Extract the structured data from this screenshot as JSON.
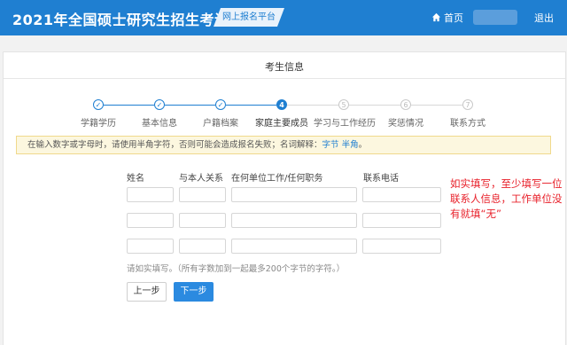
{
  "header": {
    "app_title": "2021年全国硕士研究生招生考试",
    "platform_tag": "网上报名平台",
    "home_label": "首页",
    "logout_label": "退出"
  },
  "card": {
    "title": "考生信息"
  },
  "steps": [
    {
      "number": "✓",
      "label": "学籍学历",
      "state": "done"
    },
    {
      "number": "✓",
      "label": "基本信息",
      "state": "done"
    },
    {
      "number": "✓",
      "label": "户籍档案",
      "state": "done"
    },
    {
      "number": "4",
      "label": "家庭主要成员",
      "state": "active"
    },
    {
      "number": "5",
      "label": "学习与工作经历",
      "state": "todo"
    },
    {
      "number": "6",
      "label": "奖惩情况",
      "state": "todo"
    },
    {
      "number": "7",
      "label": "联系方式",
      "state": "todo"
    }
  ],
  "notice": {
    "text": "在输入数字或字母时，请使用半角字符，否则可能会造成报名失败；名词解释：",
    "link1": "字节",
    "link2": "半角",
    "end": "。"
  },
  "form": {
    "columns": {
      "name": "姓名",
      "relation": "与本人关系",
      "work_unit": "在何单位工作/任何职务",
      "phone": "联系电话"
    },
    "hint": "请如实填写。（所有字数加到一起最多200个字节的字符。）",
    "prev_button": "上一步",
    "next_button": "下一步"
  },
  "annotation": "如实填写，至少填写一位联系人信息，工作单位没有就填“无”",
  "colors": {
    "header_blue": "#1f7fd1",
    "notice_bg": "#fcf7df",
    "annotation_red": "#e8202a"
  }
}
